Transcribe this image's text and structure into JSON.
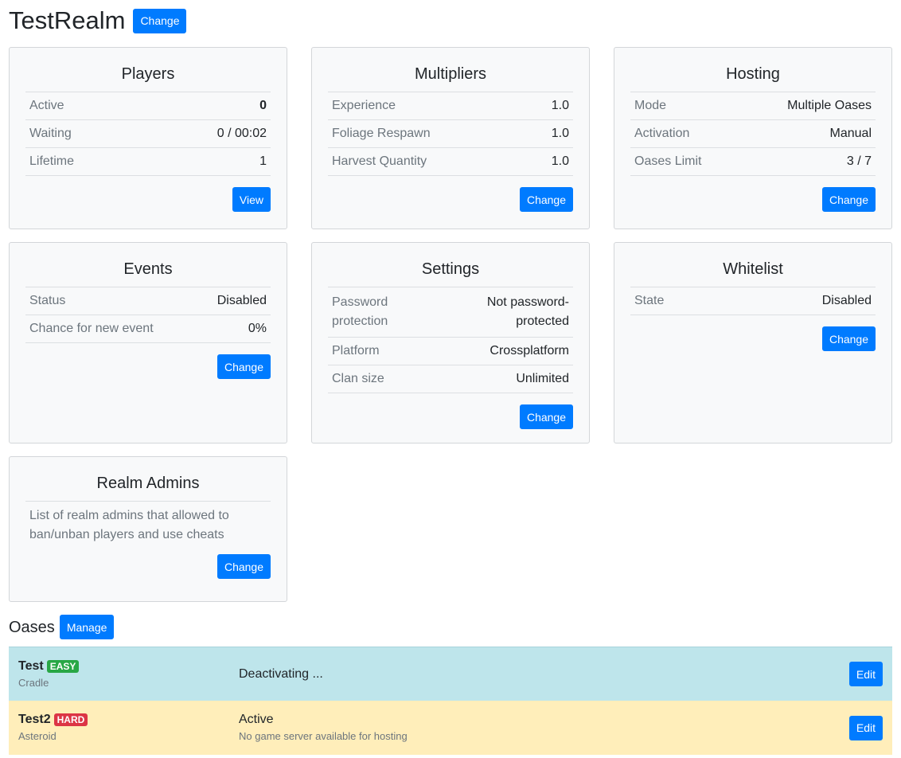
{
  "realm": {
    "title": "TestRealm",
    "change_label": "Change"
  },
  "players": {
    "title": "Players",
    "rows": [
      {
        "label": "Active",
        "value": "0"
      },
      {
        "label": "Waiting",
        "value": "0 / 00:02"
      },
      {
        "label": "Lifetime",
        "value": "1"
      }
    ],
    "button": "View"
  },
  "multipliers": {
    "title": "Multipliers",
    "rows": [
      {
        "label": "Experience",
        "value": "1.0"
      },
      {
        "label": "Foliage Respawn",
        "value": "1.0"
      },
      {
        "label": "Harvest Quantity",
        "value": "1.0"
      }
    ],
    "button": "Change"
  },
  "hosting": {
    "title": "Hosting",
    "rows": [
      {
        "label": "Mode",
        "value": "Multiple Oases"
      },
      {
        "label": "Activation",
        "value": "Manual"
      },
      {
        "label": "Oases Limit",
        "value": "3 / 7"
      }
    ],
    "button": "Change"
  },
  "events": {
    "title": "Events",
    "rows": [
      {
        "label": "Status",
        "value": "Disabled"
      },
      {
        "label": "Chance for new event",
        "value": "0%"
      }
    ],
    "button": "Change"
  },
  "settings": {
    "title": "Settings",
    "rows": [
      {
        "label": "Password protection",
        "value": "Not password-protected"
      },
      {
        "label": "Platform",
        "value": "Crossplatform"
      },
      {
        "label": "Clan size",
        "value": "Unlimited"
      }
    ],
    "button": "Change"
  },
  "whitelist": {
    "title": "Whitelist",
    "rows": [
      {
        "label": "State",
        "value": "Disabled"
      }
    ],
    "button": "Change"
  },
  "realm_admins": {
    "title": "Realm Admins",
    "description": "List of realm admins that allowed to ban/unban players and use cheats",
    "button": "Change"
  },
  "oases": {
    "title": "Oases",
    "manage_label": "Manage",
    "items": [
      {
        "name": "Test",
        "difficulty": "EASY",
        "type": "Cradle",
        "status": "Deactivating ...",
        "note": "",
        "edit_label": "Edit"
      },
      {
        "name": "Test2",
        "difficulty": "HARD",
        "type": "Asteroid",
        "status": "Active",
        "note": "No game server available for hosting",
        "edit_label": "Edit"
      }
    ]
  },
  "colors": {
    "primary": "#007bff",
    "info_row": "#bee5eb",
    "warning_row": "#ffeeba",
    "badge_easy": "#28a745",
    "badge_hard": "#dc3545"
  }
}
